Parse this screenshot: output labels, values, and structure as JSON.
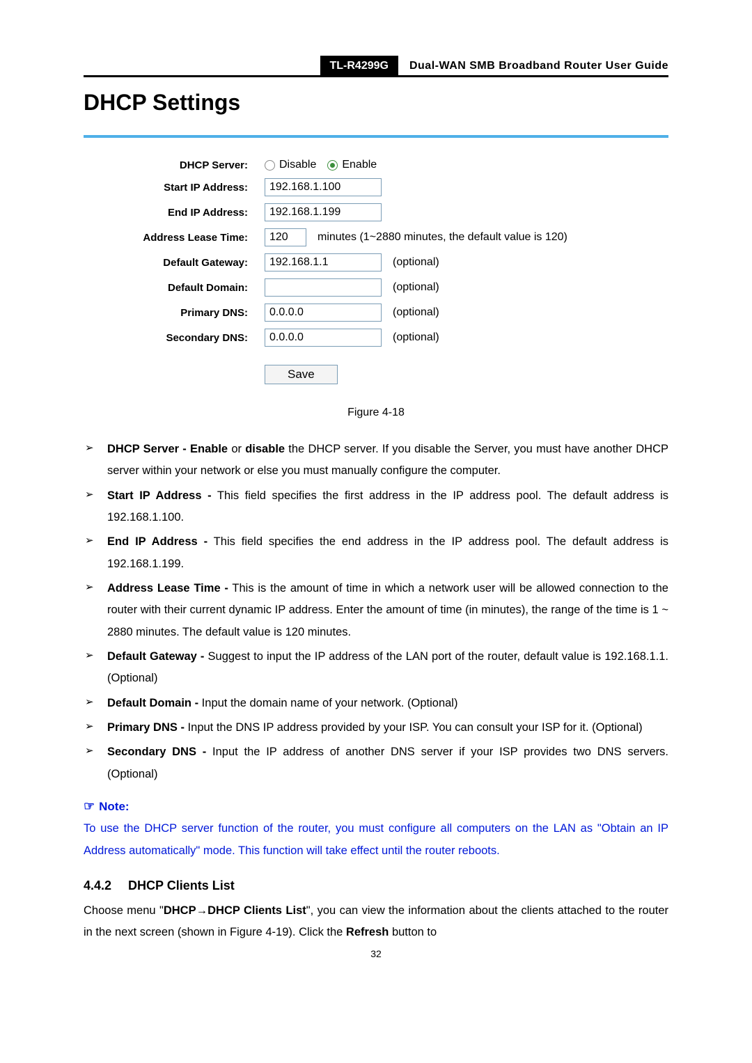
{
  "header": {
    "model": "TL-R4299G",
    "guide": "Dual-WAN SMB Broadband Router User Guide"
  },
  "panel": {
    "title": "DHCP Settings",
    "labels": {
      "server": "DHCP Server:",
      "startip": "Start IP Address:",
      "endip": "End IP Address:",
      "lease": "Address Lease Time:",
      "gateway": "Default Gateway:",
      "domain": "Default Domain:",
      "pdns": "Primary DNS:",
      "sdns": "Secondary DNS:"
    },
    "radios": {
      "disable": "Disable",
      "enable": "Enable"
    },
    "values": {
      "startip": "192.168.1.100",
      "endip": "192.168.1.199",
      "lease": "120",
      "gateway": "192.168.1.1",
      "domain": "",
      "pdns": "0.0.0.0",
      "sdns": "0.0.0.0"
    },
    "hints": {
      "lease": "minutes (1~2880 minutes, the default value is 120)",
      "optional": "(optional)"
    },
    "save": "Save"
  },
  "figure_caption": "Figure 4-18",
  "bullets": {
    "b0_s": "DHCP Server - Enable",
    "b0_m": " or ",
    "b0_s2": "disable",
    "b0_r": " the DHCP server. If you disable the Server, you must have another DHCP server within your network or else you must manually configure the computer.",
    "b1_s": "Start IP Address -",
    "b1_r": " This field specifies the first address in the IP address pool. The default address is 192.168.1.100.",
    "b2_s": "End IP Address -",
    "b2_r": " This field specifies the end address in the IP address pool. The default address is 192.168.1.199.",
    "b3_s": "Address Lease Time -",
    "b3_r": " This is the amount of time in which a network user will be allowed connection to the router with their current dynamic IP address. Enter the amount of time (in minutes), the range of the time is 1 ~ 2880 minutes. The default value is 120 minutes.",
    "b4_s": "Default Gateway -",
    "b4_r": " Suggest to input the IP address of the LAN port of the router, default value is 192.168.1.1. (Optional)",
    "b5_s": "Default Domain -",
    "b5_r": " Input the domain name of your network. (Optional)",
    "b6_s": "Primary DNS -",
    "b6_r": " Input the DNS IP address provided by your ISP. You can consult your ISP for it. (Optional)",
    "b7_s": "Secondary DNS -",
    "b7_r": " Input the IP address of another DNS server if your ISP provides two DNS servers. (Optional)"
  },
  "note": {
    "head": "Note:",
    "body": "To use the DHCP server function of the router, you must configure all computers on the LAN as \"Obtain an IP Address automatically\" mode. This function will take effect until the router reboots."
  },
  "section": {
    "num": "4.4.2",
    "title": "DHCP Clients List",
    "p_a": "Choose menu \"",
    "p_b": "DHCP",
    "p_arrow": "→",
    "p_c": "DHCP Clients List",
    "p_d": "\", you can view the information about the clients attached to the router in the next screen (shown in Figure 4-19). Click the ",
    "p_e": "Refresh",
    "p_f": " button to"
  },
  "page_number": "32"
}
